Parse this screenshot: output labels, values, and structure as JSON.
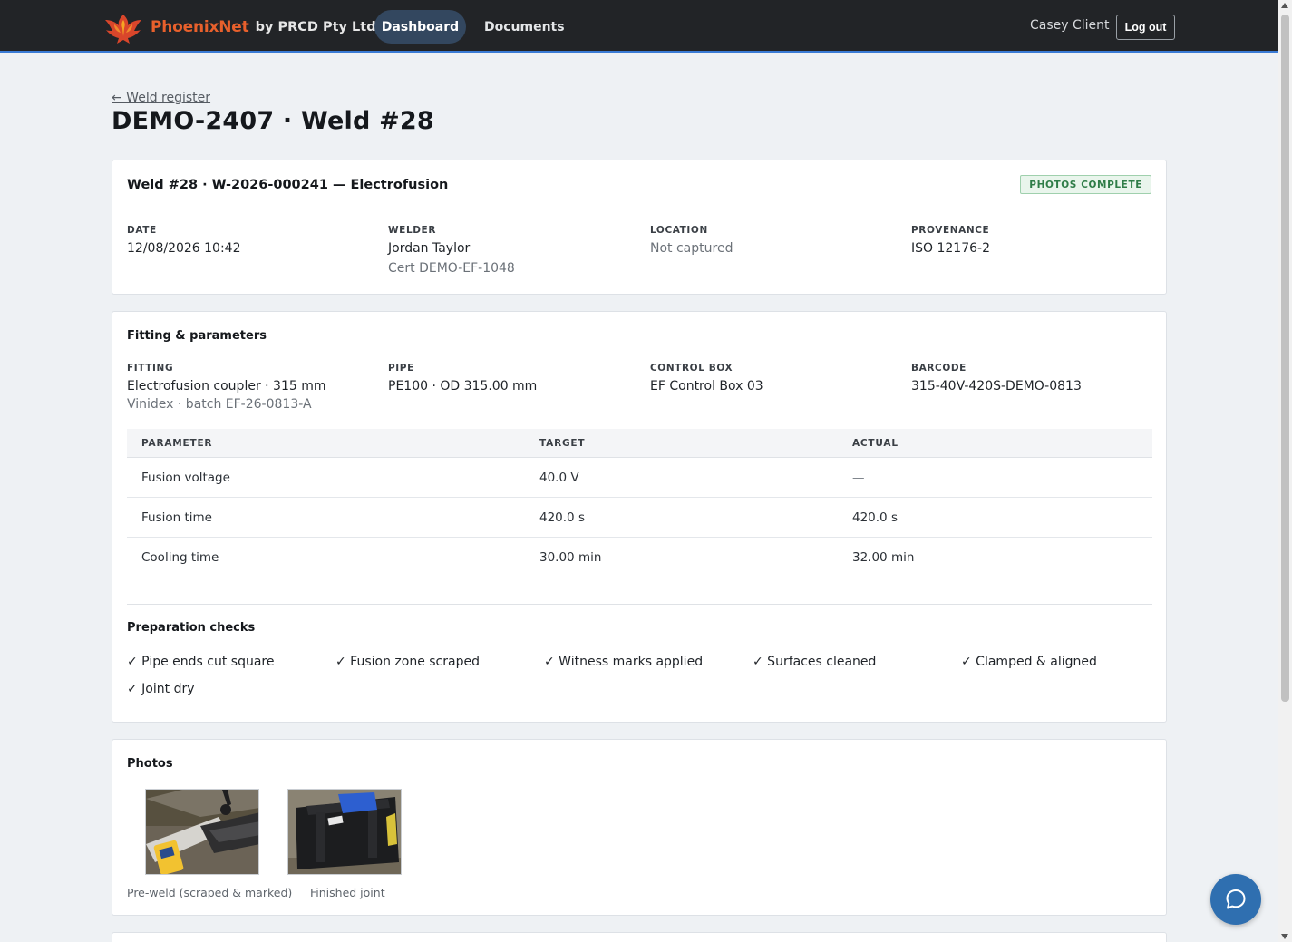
{
  "nav": {
    "brand_name": "PhoenixNet",
    "brand_by": "by PRCD Pty Ltd",
    "tabs": [
      {
        "label": "Dashboard",
        "active": true
      },
      {
        "label": "Documents",
        "active": false
      }
    ],
    "user_name": "Casey Client",
    "logout_label": "Log out"
  },
  "header": {
    "back_link": "← Weld register",
    "title": "DEMO-2407 · Weld #28"
  },
  "summary": {
    "title": "Weld #28 · W-2026-000241 — Electrofusion",
    "badge": "PHOTOS COMPLETE",
    "fields": [
      {
        "label": "DATE",
        "value": "12/08/2026 10:42",
        "sub": ""
      },
      {
        "label": "WELDER",
        "value": "Jordan Taylor",
        "sub": "Cert DEMO-EF-1048"
      },
      {
        "label": "LOCATION",
        "value": "Not captured",
        "sub": ""
      },
      {
        "label": "PROVENANCE",
        "value": "ISO 12176-2",
        "sub": ""
      }
    ]
  },
  "fitting": {
    "title": "Fitting & parameters",
    "fields": [
      {
        "label": "FITTING",
        "value": "Electrofusion coupler · 315 mm",
        "sub": "Vinidex · batch EF-26-0813-A"
      },
      {
        "label": "PIPE",
        "value": "PE100 · OD 315.00 mm",
        "sub": ""
      },
      {
        "label": "CONTROL BOX",
        "value": "EF Control Box 03",
        "sub": ""
      },
      {
        "label": "BARCODE",
        "value": "315-40V-420S-DEMO-0813",
        "sub": ""
      }
    ],
    "table": {
      "headers": [
        "PARAMETER",
        "TARGET",
        "ACTUAL"
      ],
      "rows": [
        [
          "Fusion voltage",
          "40.0 V",
          "—"
        ],
        [
          "Fusion time",
          "420.0 s",
          "420.0 s"
        ],
        [
          "Cooling time",
          "30.00 min",
          "32.00 min"
        ]
      ]
    }
  },
  "prep": {
    "title": "Preparation checks",
    "checks": [
      "✓ Pipe ends cut square",
      "✓ Fusion zone scraped",
      "✓ Witness marks applied",
      "✓ Surfaces cleaned",
      "✓ Clamped & aligned",
      "✓ Joint dry"
    ]
  },
  "photos": {
    "title": "Photos",
    "items": [
      {
        "caption": "Pre-weld (scraped & marked)"
      },
      {
        "caption": "Finished joint"
      }
    ]
  },
  "colors": {
    "accent": "#3a7bd5",
    "brand": "#e8602c",
    "nav_bg": "#222427",
    "badge_green": "#2f7d48",
    "chat_button": "#2f6fb0"
  },
  "icons": [
    "phoenix-logo-icon",
    "chat-bubble-icon"
  ]
}
